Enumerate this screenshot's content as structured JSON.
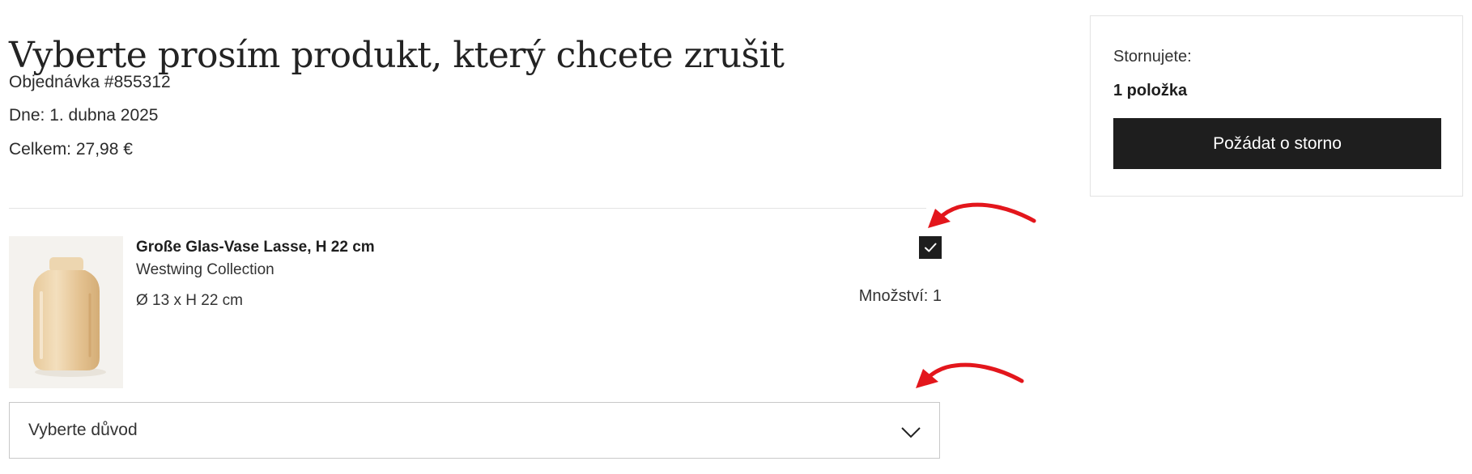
{
  "page": {
    "title": "Vyberte prosím produkt, který chcete zrušit",
    "order_number": "Objednávka #855312",
    "date": "Dne: 1. dubna 2025",
    "total": "Celkem: 27,98 €"
  },
  "item": {
    "name": "Große Glas-Vase Lasse, H 22 cm",
    "brand": "Westwing Collection",
    "dimensions": "Ø 13 x H 22 cm",
    "quantity": "Množství: 1",
    "selected": true
  },
  "reason_select": {
    "placeholder": "Vyberte důvod"
  },
  "summary": {
    "label": "Stornujete:",
    "count": "1 položka",
    "button_label": "Požádat o storno"
  },
  "icons": {
    "checkbox": "check-icon",
    "dropdown": "chevron-down-icon",
    "annotations": "red-arrow-icon"
  },
  "colors": {
    "primary": "#1e1e1e",
    "annotation": "#e3161c"
  }
}
